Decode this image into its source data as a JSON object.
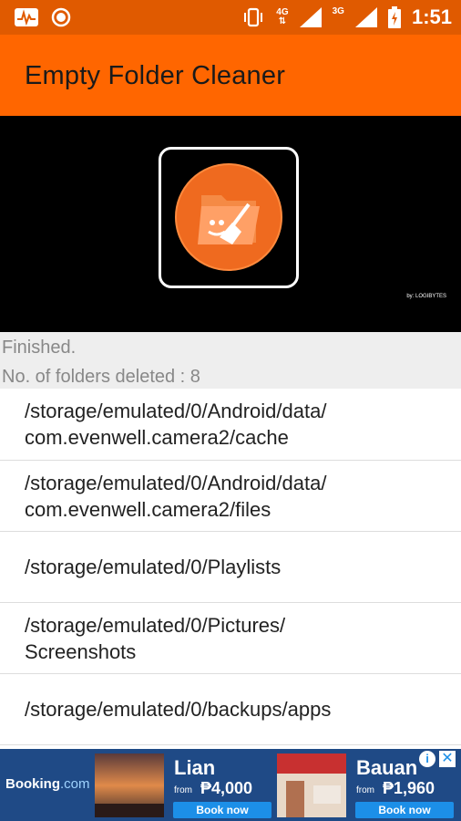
{
  "status_bar": {
    "time": "1:51",
    "network_left": "4G",
    "network_right": "3G",
    "icons": [
      "activity-icon",
      "record-icon",
      "vibrate-icon",
      "signal-icon",
      "battery-icon"
    ]
  },
  "app_bar": {
    "title": "Empty Folder Cleaner",
    "color": "#ff6600"
  },
  "banner": {
    "credit": "by: LOGIBYTES"
  },
  "status": {
    "line1": "Finished.",
    "line2": "No. of folders deleted : 8"
  },
  "folders": [
    "/storage/emulated/0/Android/data/\ncom.evenwell.camera2/cache",
    "/storage/emulated/0/Android/data/\ncom.evenwell.camera2/files",
    "/storage/emulated/0/Playlists",
    "/storage/emulated/0/Pictures/\nScreenshots",
    "/storage/emulated/0/backups/apps"
  ],
  "ad": {
    "brand": "Booking",
    "brand_suffix": ".com",
    "items": [
      {
        "name": "Lian",
        "from": "from",
        "price": "₱4,000",
        "button": "Book now"
      },
      {
        "name": "Bauan",
        "from": "from",
        "price": "₱1,960",
        "button": "Book now"
      }
    ],
    "info": "i",
    "close": "✕"
  }
}
